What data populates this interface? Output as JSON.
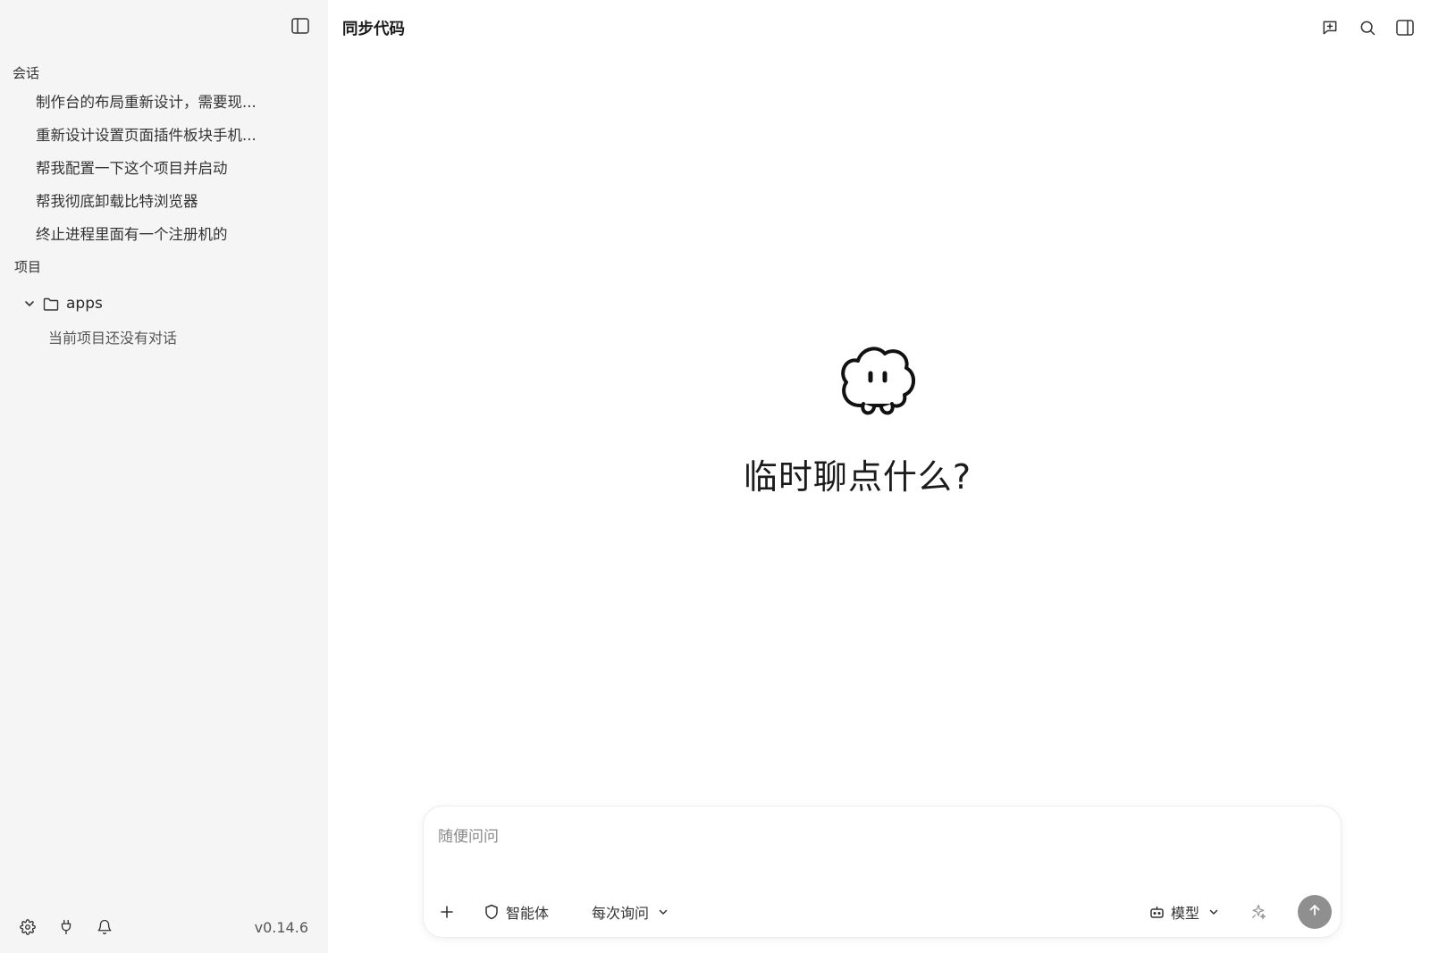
{
  "sidebar": {
    "toggle_icon": "sidebar-panel-icon",
    "sessions_title": "会话",
    "sessions": [
      {
        "label": "制作台的布局重新设计，需要现..."
      },
      {
        "label": "重新设计设置页面插件板块手机..."
      },
      {
        "label": "帮我配置一下这个项目并启动"
      },
      {
        "label": "帮我彻底卸载比特浏览器"
      },
      {
        "label": "终止进程里面有一个注册机的"
      }
    ],
    "projects_title": "项目",
    "project": {
      "name": "apps",
      "empty_text": "当前项目还没有对话"
    },
    "version": "v0.14.6"
  },
  "header": {
    "title": "同步代码",
    "actions": [
      "new-chat-icon",
      "search-icon",
      "right-panel-icon"
    ]
  },
  "hero": {
    "text": "临时聊点什么?"
  },
  "composer": {
    "placeholder": "随便问问",
    "value": "",
    "agent_label": "智能体",
    "permission_label": "每次询问",
    "model_label": "模型"
  },
  "colors": {
    "sidebar_bg": "#f5f5f5",
    "send_button": "#8f8f8f",
    "text": "#1f1f1f"
  }
}
